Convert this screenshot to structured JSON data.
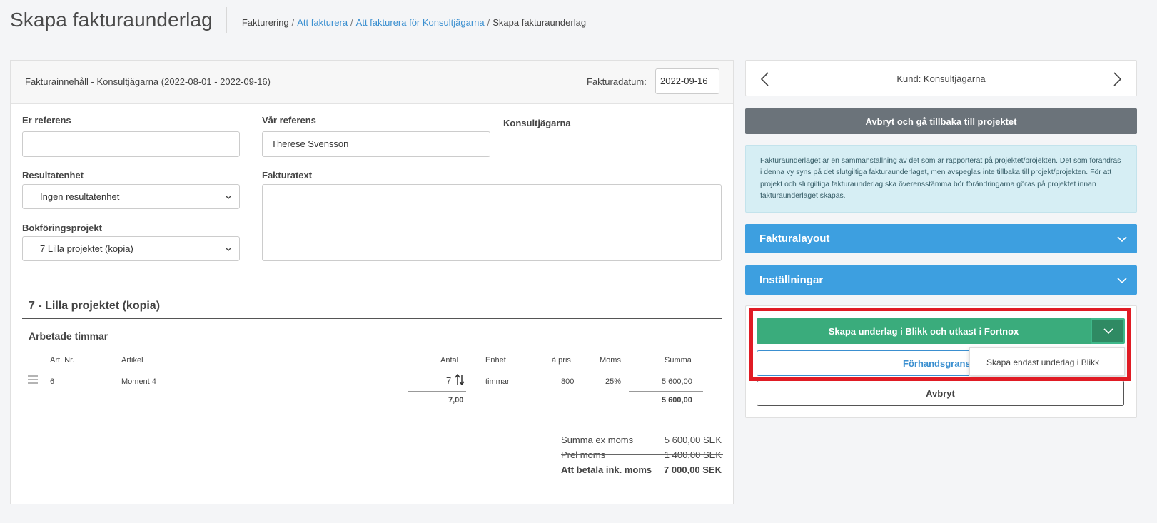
{
  "header": {
    "title": "Skapa fakturaunderlag",
    "breadcrumb": [
      {
        "label": "Fakturering",
        "link": false
      },
      {
        "label": "Att fakturera",
        "link": true
      },
      {
        "label": "Att fakturera för Konsultjägarna",
        "link": true
      },
      {
        "label": "Skapa fakturaunderlag",
        "link": false
      }
    ]
  },
  "invoice": {
    "head_title": "Fakturainnehåll - Konsultjägarna (2022-08-01 - 2022-09-16)",
    "date_label": "Fakturadatum:",
    "date_value": "2022-09-16",
    "er_referens_label": "Er referens",
    "er_referens_value": "",
    "var_referens_label": "Vår referens",
    "var_referens_value": "Therese Svensson",
    "company": "Konsultjägarna",
    "resultatenhet_label": "Resultatenhet",
    "resultatenhet_value": "Ingen resultatenhet",
    "fakturatext_label": "Fakturatext",
    "fakturatext_value": "",
    "bokforingsprojekt_label": "Bokföringsprojekt",
    "bokforingsprojekt_value": "7 Lilla projektet (kopia)",
    "project_title": "7 - Lilla projektet (kopia)",
    "section_title": "Arbetade timmar",
    "columns": {
      "art_nr": "Art. Nr.",
      "artikel": "Artikel",
      "antal": "Antal",
      "enhet": "Enhet",
      "a_pris": "à pris",
      "moms": "Moms",
      "summa": "Summa"
    },
    "row": {
      "art_nr": "6",
      "artikel": "Moment 4",
      "antal": "7",
      "enhet": "timmar",
      "a_pris": "800",
      "moms": "25%",
      "summa": "5 600,00"
    },
    "totals_row": {
      "antal": "7,00",
      "summa": "5 600,00"
    },
    "summary": {
      "ex_moms_label": "Summa ex moms",
      "ex_moms_value": "5 600,00 SEK",
      "prel_moms_label": "Prel moms",
      "prel_moms_value": "1 400,00 SEK",
      "total_label": "Att betala ink. moms",
      "total_value": "7 000,00 SEK"
    }
  },
  "sidebar": {
    "customer_label": "Kund: Konsultjägarna",
    "back_button": "Avbryt och gå tillbaka till projektet",
    "info_text": "Fakturaunderlaget är en sammanställning av det som är rapporterat på projektet/projekten. Det som förändras i denna vy syns på det slutgiltiga fakturaunderlaget, men avspeglas inte tillbaka till projekt/projekten. För att projekt och slutgiltiga fakturaunderlag ska överensstämma bör förändringarna göras på projektet innan fakturaunderlaget skapas.",
    "accordion_layout": "Fakturalayout",
    "accordion_settings": "Inställningar",
    "primary_button": "Skapa underlag i Blikk och utkast i Fortnox",
    "preview_button": "Förhandsgrans",
    "cancel_button": "Avbryt",
    "dropdown_item": "Skapa endast underlag i Blikk"
  },
  "colors": {
    "accent_blue": "#3d9fe0",
    "primary_green": "#3aac7c",
    "highlight_red": "#e01b24",
    "link_blue": "#3a8fd0"
  },
  "icons": {
    "drag": "drag-handle-icon",
    "sort": "sort-arrows-icon",
    "chevron": "chevron-down-icon",
    "prev": "chevron-left-icon",
    "next": "chevron-right-icon"
  }
}
